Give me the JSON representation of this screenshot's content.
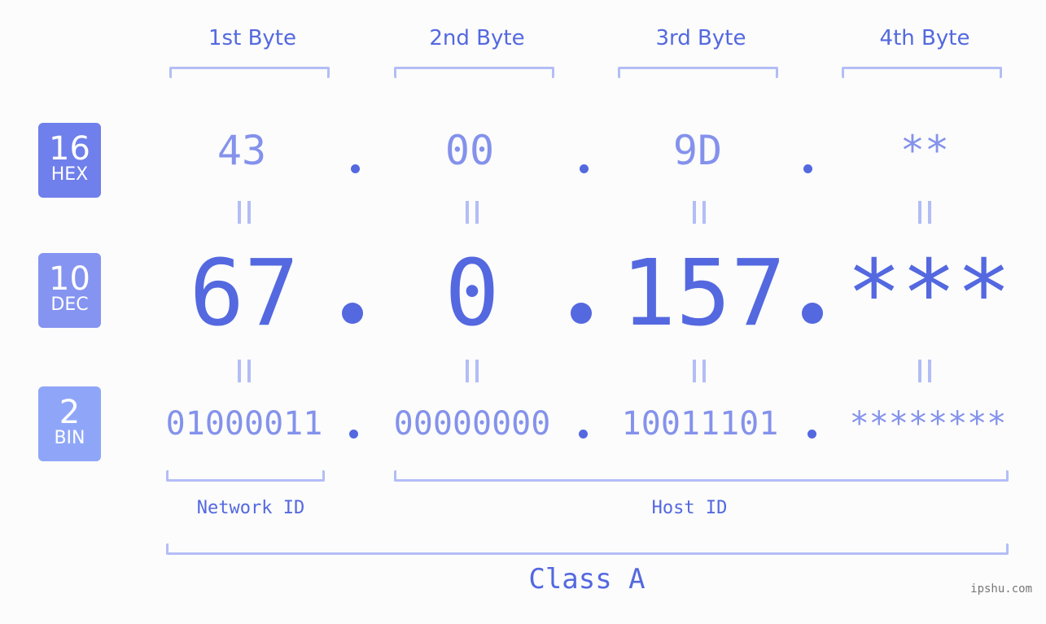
{
  "bytes": [
    {
      "label": "1st Byte",
      "hex": "43",
      "dec": "67",
      "bin": "01000011"
    },
    {
      "label": "2nd Byte",
      "hex": "00",
      "dec": "0",
      "bin": "00000000"
    },
    {
      "label": "3rd Byte",
      "hex": "9D",
      "dec": "157",
      "bin": "10011101"
    },
    {
      "label": "4th Byte",
      "hex": "**",
      "dec": "***",
      "bin": "********"
    }
  ],
  "bases": {
    "hex": {
      "num": "16",
      "label": "HEX",
      "color": "#6f7feb"
    },
    "dec": {
      "num": "10",
      "label": "DEC",
      "color": "#8594f0"
    },
    "bin": {
      "num": "2",
      "label": "BIN",
      "color": "#8fa6f8"
    }
  },
  "sections": {
    "network": "Network ID",
    "host": "Host ID",
    "class": "Class A"
  },
  "watermark": "ipshu.com"
}
